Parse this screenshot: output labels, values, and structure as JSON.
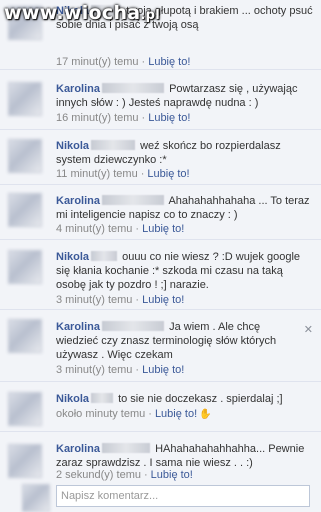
{
  "watermark": {
    "text": "www.wiocha",
    "suffix": ".pl"
  },
  "like_label": "Lubię to!",
  "separator": "·",
  "comments": [
    {
      "author": "Nikola",
      "text": "twoją głupotą i brakiem ... ochoty psuć sobie dnia i pisać z twoją osą",
      "time": "17 minut(y) temu"
    },
    {
      "author": "Karolina",
      "text": "Powtarzasz się , używając innych słów : ) Jesteś naprawdę nudna : )",
      "time": "16 minut(y) temu"
    },
    {
      "author": "Nikola",
      "text": "weź skończ bo rozpierdalasz system dziewczynko :*",
      "time": "11 minut(y) temu"
    },
    {
      "author": "Karolina",
      "text": "Ahahahahhahaha ... To teraz mi inteligencie napisz co to znaczy : )",
      "time": "4 minut(y) temu"
    },
    {
      "author": "Nikola",
      "text": "ouuu co nie wiesz ? :D wujek google się kłania kochanie :* szkoda mi czasu na taką osobę jak ty pozdro ! ;] narazie.",
      "time": "3 minut(y) temu"
    },
    {
      "author": "Karolina",
      "text": "Ja wiem . Ale chcę wiedzieć czy znasz terminologię słów których używasz . Więc czekam",
      "time": "3 minut(y) temu"
    },
    {
      "author": "Nikola",
      "text": "to sie nie doczekasz . spierdalaj ;]",
      "time": "około minuty temu"
    },
    {
      "author": "Karolina",
      "text": "HAhahahahahhahha... Pewnie zaraz sprawdzisz . I sama nie wiesz . . :)",
      "time": "2 sekund(y) temu"
    }
  ],
  "composer": {
    "placeholder": "Napisz komentarz..."
  },
  "colors": {
    "link": "#3b5998",
    "meta": "#888888",
    "background": "#f2f4f8",
    "divider": "#dfe3ee"
  },
  "icons": [
    "like-thumb-icon",
    "close-icon"
  ]
}
